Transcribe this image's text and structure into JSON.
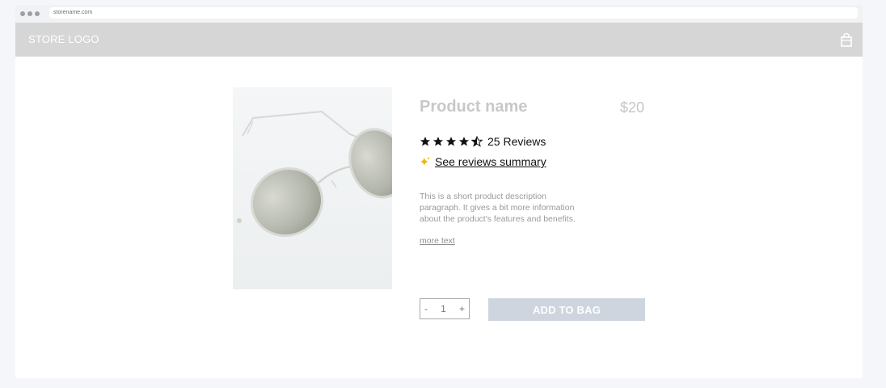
{
  "browser": {
    "url": "storename.com"
  },
  "header": {
    "logo": "STORE LOGO",
    "bag_icon": "shopping-bag-icon"
  },
  "product": {
    "name": "Product name",
    "price": "$20",
    "rating": 4.5,
    "reviews_label": "25 Reviews",
    "summary_icon": "sparkle-icon",
    "summary_link": "See reviews summary",
    "description": "This is a short product description paragraph. It gives a bit more information about the product's features and benefits.",
    "more_text": "more text",
    "image_icon": "sunglasses-image"
  },
  "purchase": {
    "decrement": "-",
    "quantity": "1",
    "increment": "+",
    "add_to_bag": "ADD TO BAG"
  },
  "colors": {
    "header_bg": "#d6d6d6",
    "button_bg": "#cfd5df",
    "sparkle": "#f2b800",
    "stars": "#111111"
  }
}
